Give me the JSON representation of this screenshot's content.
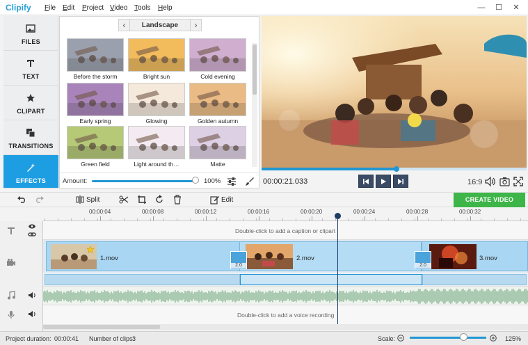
{
  "app": {
    "name": "Clipify"
  },
  "menu": [
    {
      "pre": "",
      "ul": "F",
      "post": "ile"
    },
    {
      "pre": "",
      "ul": "E",
      "post": "dit"
    },
    {
      "pre": "",
      "ul": "P",
      "post": "roject"
    },
    {
      "pre": "",
      "ul": "V",
      "post": "ideo"
    },
    {
      "pre": "",
      "ul": "T",
      "post": "ools"
    },
    {
      "pre": "",
      "ul": "H",
      "post": "elp"
    }
  ],
  "window_controls": {
    "minimize": "—",
    "maximize": "☐",
    "close": "✕"
  },
  "sidebar": {
    "items": [
      {
        "label": "FILES",
        "icon": "image-icon"
      },
      {
        "label": "TEXT",
        "icon": "text-t-icon"
      },
      {
        "label": "CLIPART",
        "icon": "star-icon"
      },
      {
        "label": "TRANSITIONS",
        "icon": "transitions-icon"
      },
      {
        "label": "EFFECTS",
        "icon": "magic-wand-icon",
        "active": true
      }
    ]
  },
  "effects": {
    "category": "Landscape",
    "items": [
      {
        "label": "Before the storm",
        "tint": "#8a90a0"
      },
      {
        "label": "Bright sun",
        "tint": "#f0b040"
      },
      {
        "label": "Cold evening",
        "tint": "#c8a0c8"
      },
      {
        "label": "Early spring",
        "tint": "#9a6fb0"
      },
      {
        "label": "Glowing",
        "tint": "#f4e6d6"
      },
      {
        "label": "Golden autumn",
        "tint": "#e8b070"
      },
      {
        "label": "Green field",
        "tint": "#a8c060"
      },
      {
        "label": "Light around th…",
        "tint": "#f2e8f0"
      },
      {
        "label": "Matte",
        "tint": "#d8c8e0"
      }
    ],
    "amount_label": "Amount:",
    "amount_value": "100%",
    "amount_fraction": 1.0
  },
  "player": {
    "timecode": "00:00:21.033",
    "aspect": "16:9",
    "progress_fraction": 0.51
  },
  "toolbar": {
    "split_label": "Split",
    "edit_label": "Edit",
    "create_label": "CREATE VIDEO"
  },
  "timeline": {
    "ticks": [
      "00:00:04",
      "00:00:08",
      "00:00:12",
      "00:00:16",
      "00:00:20",
      "00:00:24",
      "00:00:28",
      "00:00:32"
    ],
    "caption_hint": "Double-click to add a caption or clipart",
    "voice_hint": "Double-click to add a voice recording",
    "clips": [
      {
        "label": "1.mov"
      },
      {
        "label": "2.mov"
      },
      {
        "label": "3.mov"
      }
    ],
    "transitions": [
      {
        "duration": "2.0"
      },
      {
        "duration": "2.0"
      }
    ]
  },
  "status": {
    "duration_label": "Project duration:",
    "duration_value": "00:00:41",
    "clips_label": "Number of clips:",
    "clips_value": "3",
    "scale_label": "Scale:",
    "scale_value": "125%",
    "scale_fraction": 0.7
  },
  "colors": {
    "accent": "#1d9ee3",
    "create": "#3db548",
    "playhead": "#1b3d66"
  }
}
